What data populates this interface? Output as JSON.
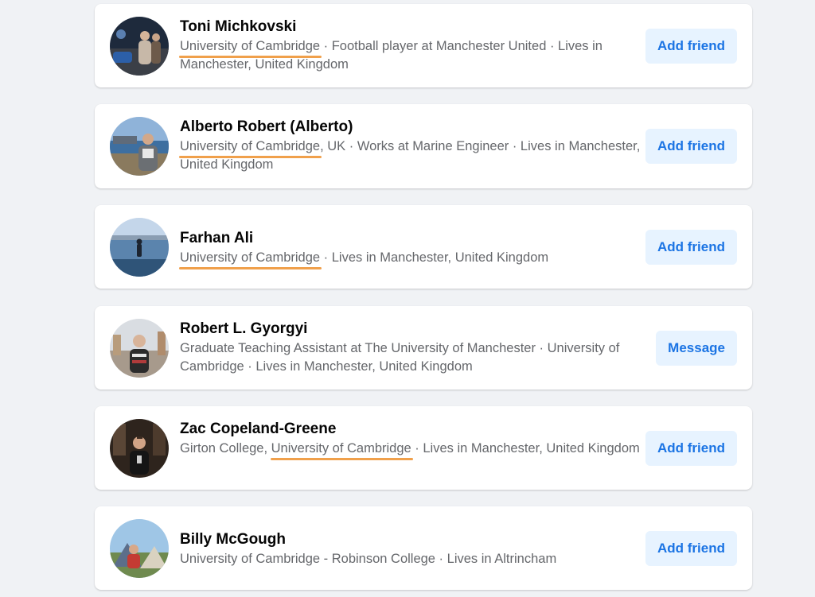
{
  "results": [
    {
      "name": "Toni Michkovski",
      "highlight": "University of Cambridge",
      "rest": " · Football player at Manchester United · Lives in Manchester, United Kingdom",
      "pre": "",
      "button": "Add friend",
      "highlighted": true,
      "avatar_icon": "person-at-night-photo"
    },
    {
      "name": "Alberto Robert (Alberto)",
      "highlight": "University of Cambridge",
      "rest": ", UK · Works at Marine Engineer · Lives in Manchester, United Kingdom",
      "pre": "",
      "button": "Add friend",
      "highlighted": true,
      "avatar_icon": "person-at-seaside-photo"
    },
    {
      "name": "Farhan Ali",
      "highlight": "University of Cambridge",
      "rest": " · Lives in Manchester, United Kingdom",
      "pre": "",
      "button": "Add friend",
      "highlighted": true,
      "avatar_icon": "person-on-lake-photo"
    },
    {
      "name": "Robert L. Gyorgyi",
      "highlight": "",
      "rest": "",
      "pre": "Graduate Teaching Assistant at The University of Manchester · University of Cambridge · Lives in Manchester, United Kingdom",
      "button": "Message",
      "highlighted": false,
      "avatar_icon": "person-in-city-photo"
    },
    {
      "name": "Zac Copeland-Greene",
      "highlight": "University of Cambridge",
      "rest": " · Lives in Manchester, United Kingdom",
      "pre": "Girton College, ",
      "button": "Add friend",
      "highlighted": true,
      "avatar_icon": "person-indoors-photo"
    },
    {
      "name": "Billy McGough",
      "highlight": "",
      "rest": "",
      "pre": "University of Cambridge - Robinson College · Lives in Altrincham",
      "button": "Add friend",
      "highlighted": false,
      "avatar_icon": "person-camping-photo"
    }
  ],
  "colors": {
    "background": "#f0f2f5",
    "card": "#ffffff",
    "button_bg": "#e7f3ff",
    "button_text": "#1b74e4",
    "underline": "#f0a04b",
    "secondary_text": "#65676b"
  }
}
